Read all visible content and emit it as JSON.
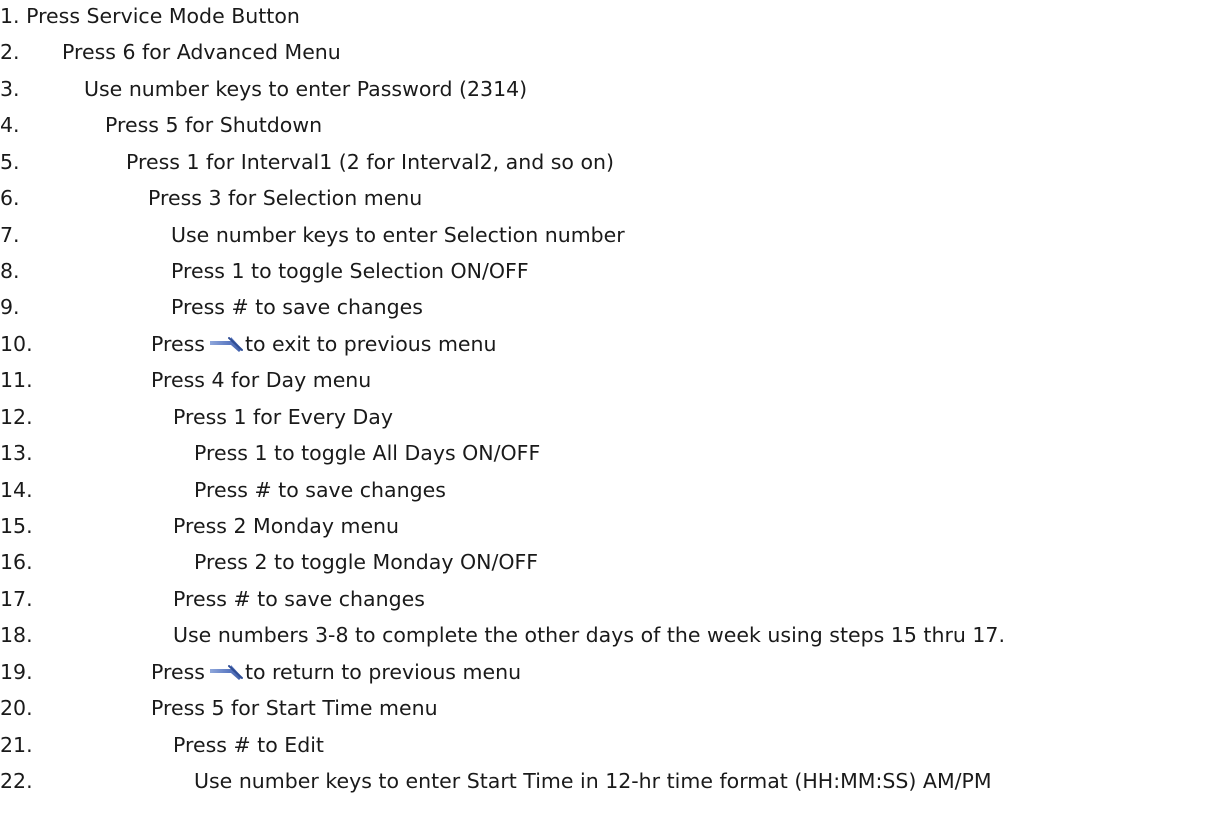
{
  "steps": [
    {
      "text": "1. Press Service Mode Button"
    },
    {
      "num": "2.",
      "text": "Press 6 for Advanced Menu"
    },
    {
      "num": "3.",
      "text": "Use number keys to enter Password (2314)"
    },
    {
      "num": "4.",
      "text": "Press 5 for Shutdown"
    },
    {
      "num": "5.",
      "text": "Press 1 for Interval1 (2 for Interval2, and so on)"
    },
    {
      "num": "6.",
      "text": "Press 3 for Selection menu"
    },
    {
      "num": "7.",
      "text": "Use number keys to enter Selection number"
    },
    {
      "num": "8.",
      "text": "Press 1 to toggle Selection ON/OFF"
    },
    {
      "num": "9.",
      "text": "Press # to save changes"
    },
    {
      "num": "10.",
      "before": "Press",
      "after": "to exit to previous menu",
      "icon": "back-arrow-icon"
    },
    {
      "num": "11.",
      "text": "Press 4 for Day menu"
    },
    {
      "num": "12.",
      "text": "Press 1 for Every Day"
    },
    {
      "num": "13.",
      "text": "Press 1 to toggle All Days ON/OFF"
    },
    {
      "num": "14.",
      "text": "Press # to save changes"
    },
    {
      "num": "15.",
      "text": "Press 2 Monday menu"
    },
    {
      "num": "16.",
      "text": "Press 2 to toggle Monday ON/OFF"
    },
    {
      "num": "17.",
      "text": "Press # to save changes"
    },
    {
      "num": "18.",
      "text": "Use numbers 3-8 to complete the other days of the week using steps 15 thru 17."
    },
    {
      "num": "19.",
      "before": "Press",
      "after": "to return to previous menu",
      "icon": "back-arrow-icon"
    },
    {
      "num": "20.",
      "text": "Press 5 for Start Time menu"
    },
    {
      "num": "21.",
      "text": "Press # to Edit"
    },
    {
      "num": "22.",
      "text": "Use number keys to enter Start Time in 12-hr time format (HH:MM:SS) AM/PM"
    }
  ],
  "colors": {
    "text": "#1a1a1a",
    "arrow_icon": "#5b79c2",
    "background": "#ffffff"
  }
}
